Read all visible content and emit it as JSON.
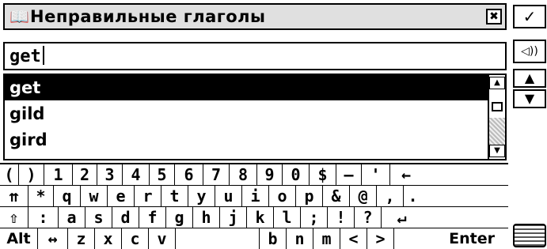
{
  "window": {
    "title": "Неправильные глаголы",
    "title_icon": "book-icon",
    "close_glyph": "✖"
  },
  "input": {
    "value": "get"
  },
  "list": {
    "items": [
      "get",
      "gild",
      "gird"
    ],
    "selected_index": 0,
    "scroll_up_glyph": "▲",
    "scroll_down_glyph": "▼"
  },
  "keyboard": {
    "row1": [
      "(",
      ")",
      "1",
      "2",
      "3",
      "4",
      "5",
      "6",
      "7",
      "8",
      "9",
      "0",
      "$",
      "–",
      "'",
      "←"
    ],
    "row2": [
      "⇈",
      "*",
      "q",
      "w",
      "e",
      "r",
      "t",
      "y",
      "u",
      "i",
      "o",
      "p",
      "&",
      "@",
      ",",
      "."
    ],
    "row3": [
      "⇧",
      ":",
      "a",
      "s",
      "d",
      "f",
      "g",
      "h",
      "j",
      "k",
      "l",
      ";",
      "!",
      "?",
      "↵"
    ],
    "row4": [
      "Alt",
      "↔",
      "z",
      "x",
      "c",
      "v",
      "",
      "b",
      "n",
      "m",
      "<",
      ">",
      "Enter"
    ]
  },
  "side_panel": {
    "ok_glyph": "✓",
    "sound_glyph": "◁))",
    "up_glyph": "▲",
    "down_glyph": "▼",
    "keyboard_icon": "keyboard-icon"
  }
}
